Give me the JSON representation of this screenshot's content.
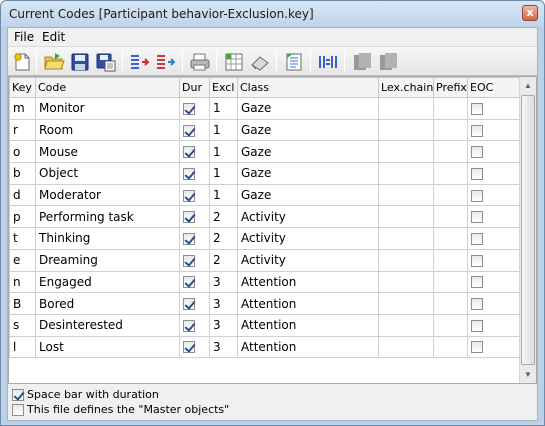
{
  "window": {
    "title": "Current Codes [Participant behavior-Exclusion.key]",
    "close_label": "x"
  },
  "menu": {
    "items": [
      "File",
      "Edit"
    ]
  },
  "toolbar": {
    "buttons": [
      "new-icon",
      "open-icon",
      "save-icon",
      "save-as-icon",
      "import-icon",
      "export-icon",
      "print-icon",
      "spreadsheet-icon",
      "erase-icon",
      "edit-list-icon",
      "columns-icon",
      "copy-icon",
      "paste-icon"
    ]
  },
  "table": {
    "headers": [
      "Key",
      "Code",
      "Dur",
      "Excl",
      "Class",
      "Lex.chain",
      "Prefix",
      "EOC"
    ],
    "rows": [
      {
        "key": "m",
        "code": "Monitor",
        "dur": true,
        "excl": "1",
        "class": "Gaze",
        "lex": "",
        "prefix": "",
        "eoc": false
      },
      {
        "key": "r",
        "code": "Room",
        "dur": true,
        "excl": "1",
        "class": "Gaze",
        "lex": "",
        "prefix": "",
        "eoc": false
      },
      {
        "key": "o",
        "code": "Mouse",
        "dur": true,
        "excl": "1",
        "class": "Gaze",
        "lex": "",
        "prefix": "",
        "eoc": false
      },
      {
        "key": "b",
        "code": "Object",
        "dur": true,
        "excl": "1",
        "class": "Gaze",
        "lex": "",
        "prefix": "",
        "eoc": false
      },
      {
        "key": "d",
        "code": "Moderator",
        "dur": true,
        "excl": "1",
        "class": "Gaze",
        "lex": "",
        "prefix": "",
        "eoc": false
      },
      {
        "key": "p",
        "code": "Performing task",
        "dur": true,
        "excl": "2",
        "class": "Activity",
        "lex": "",
        "prefix": "",
        "eoc": false
      },
      {
        "key": "t",
        "code": "Thinking",
        "dur": true,
        "excl": "2",
        "class": "Activity",
        "lex": "",
        "prefix": "",
        "eoc": false
      },
      {
        "key": "e",
        "code": "Dreaming",
        "dur": true,
        "excl": "2",
        "class": "Activity",
        "lex": "",
        "prefix": "",
        "eoc": false
      },
      {
        "key": "n",
        "code": "Engaged",
        "dur": true,
        "excl": "3",
        "class": "Attention",
        "lex": "",
        "prefix": "",
        "eoc": false
      },
      {
        "key": "B",
        "code": "Bored",
        "dur": true,
        "excl": "3",
        "class": "Attention",
        "lex": "",
        "prefix": "",
        "eoc": false
      },
      {
        "key": "s",
        "code": "Desinterested",
        "dur": true,
        "excl": "3",
        "class": "Attention",
        "lex": "",
        "prefix": "",
        "eoc": false
      },
      {
        "key": "l",
        "code": "Lost",
        "dur": true,
        "excl": "3",
        "class": "Attention",
        "lex": "",
        "prefix": "",
        "eoc": false
      }
    ]
  },
  "options": {
    "space_bar": {
      "label": "Space bar with duration",
      "checked": true
    },
    "master_objects": {
      "label": "This file defines the \"Master objects\"",
      "checked": false
    }
  },
  "colors": {
    "title_bar": "#bfd3ea",
    "close_button": "#d0674f",
    "check_mark": "#2a4f8a"
  }
}
